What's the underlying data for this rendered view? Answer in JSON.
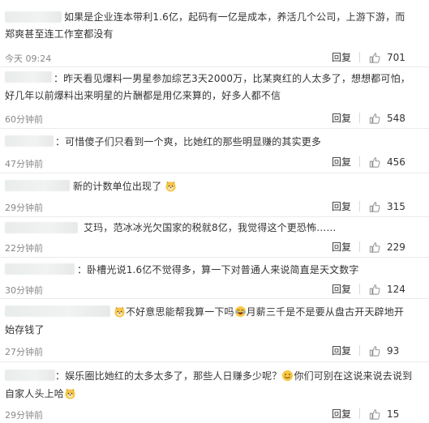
{
  "comments": [
    {
      "line1": "如果是企业连本带利1.6亿，起码有一亿是成本，养活几个公司，上游下游，而",
      "line2": "郑爽甚至连工作室都没有",
      "time": "今天 09:24",
      "reply": "回复",
      "likes": "701"
    },
    {
      "line1": "：昨天看见爆料一男星参加综艺3天2000万，比某爽红的人太多了，想想都可怕，",
      "line2": "好几年以前爆料出来明星的片酬都是用亿来算的，好多人都不信",
      "time": "60分钟前",
      "reply": "回复",
      "likes": "548"
    },
    {
      "line1": "：可惜傻子们只看到一个爽，比她红的那些明显赚的其实更多",
      "time": "47分钟前",
      "reply": "回复",
      "likes": "456"
    },
    {
      "line1": "新的计数单位出现了",
      "time": "29分钟前",
      "reply": "回复",
      "likes": "315"
    },
    {
      "line1": "艾玛，范冰冰光欠国家的税就8亿，我觉得这个更恐怖……",
      "time": "22分钟前",
      "reply": "回复",
      "likes": "229"
    },
    {
      "line1": "：卧槽光说1.6亿不觉得多，算一下对普通人来说简直是天文数字",
      "time": "30分钟前",
      "reply": "回复",
      "likes": "124"
    },
    {
      "line1_a": "不好意思能帮我算一下吗",
      "line1_b": "月薪三千是不是要从盘古开天辟地开",
      "line2": "始存钱了",
      "time": "27分钟前",
      "reply": "回复",
      "likes": "93"
    },
    {
      "line1_a": "：娱乐圈比她红的太多太多了，那些人日赚多少呢？",
      "line1_b": "你们可别在这说来说去说到",
      "line2": "自家人头上哈",
      "time": "29分钟前",
      "reply": "回复",
      "likes": "15"
    }
  ],
  "icons": {
    "like": "thumbs-up-icon",
    "emoji_doge": "doge-emoji",
    "emoji_laugh": "laugh-cry-emoji",
    "emoji_smile": "smile-emoji"
  }
}
